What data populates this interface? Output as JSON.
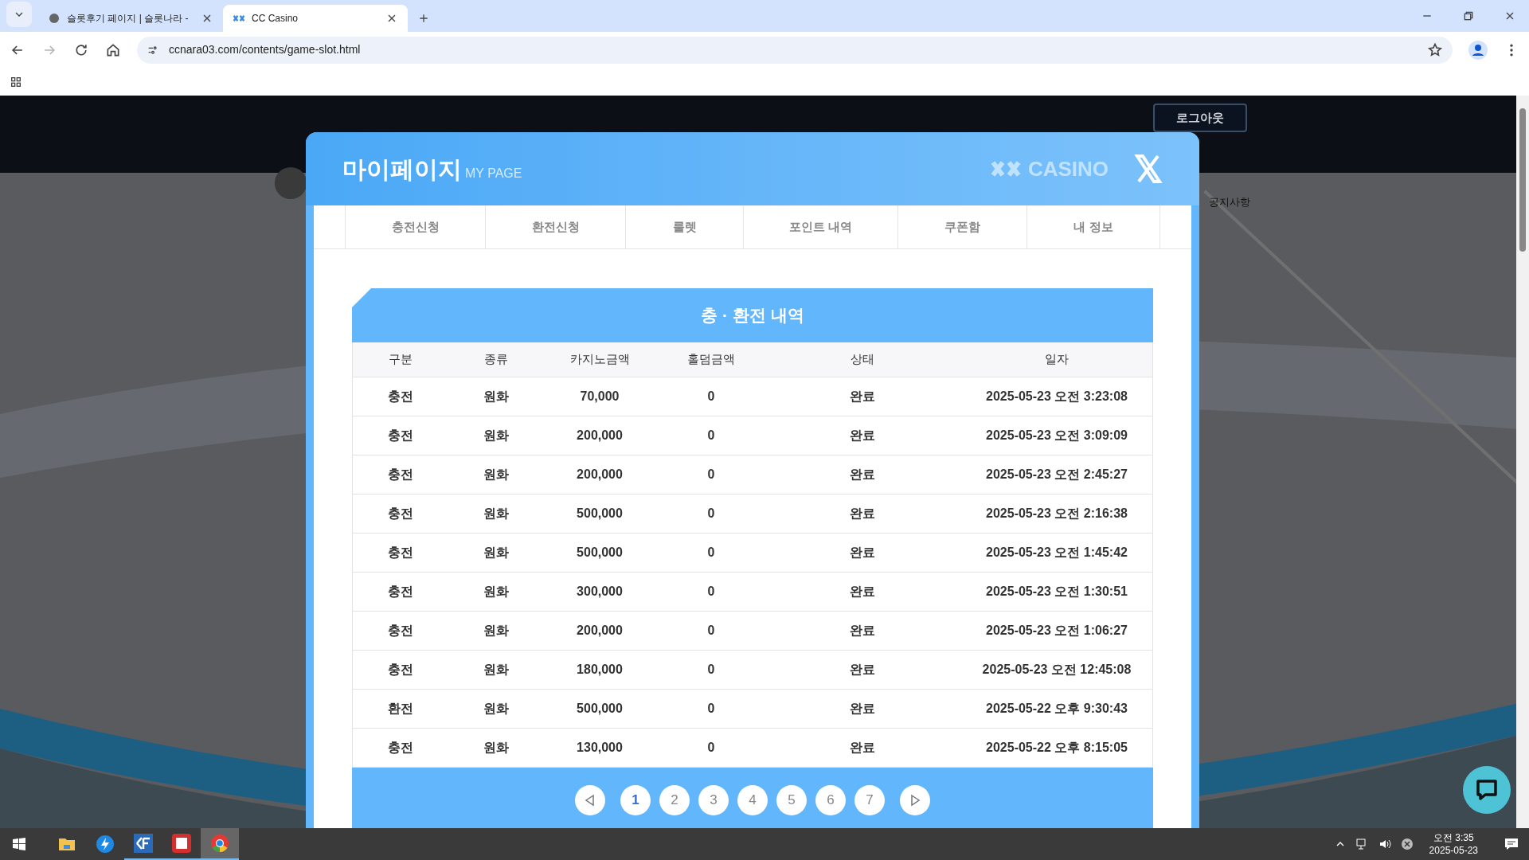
{
  "browser": {
    "tabs": [
      {
        "title": "슬롯후기 페이지 | 슬롯나라 -",
        "selected": false
      },
      {
        "title": "CC Casino",
        "selected": true
      }
    ],
    "url": "ccnara03.com/contents/game-slot.html"
  },
  "site": {
    "logout": "로그아웃",
    "notice": "공지사항"
  },
  "modal": {
    "title": "마이페이지",
    "subtitle": "MY PAGE",
    "logo": "CASINO",
    "tabs": [
      {
        "label": "충전신청",
        "selected": false
      },
      {
        "label": "환전신청",
        "selected": false
      },
      {
        "label": "룰렛",
        "selected": false
      },
      {
        "label": "포인트 내역",
        "selected": false
      },
      {
        "label": "쿠폰함",
        "selected": false
      },
      {
        "label": "내 정보",
        "selected": false
      }
    ],
    "table": {
      "title": "충 · 환전 내역",
      "columns": [
        "구분",
        "종류",
        "카지노금액",
        "홀덤금액",
        "상태",
        "일자"
      ],
      "rows": [
        [
          "충전",
          "원화",
          "70,000",
          "0",
          "완료",
          "2025-05-23 오전 3:23:08"
        ],
        [
          "충전",
          "원화",
          "200,000",
          "0",
          "완료",
          "2025-05-23 오전 3:09:09"
        ],
        [
          "충전",
          "원화",
          "200,000",
          "0",
          "완료",
          "2025-05-23 오전 2:45:27"
        ],
        [
          "충전",
          "원화",
          "500,000",
          "0",
          "완료",
          "2025-05-23 오전 2:16:38"
        ],
        [
          "충전",
          "원화",
          "500,000",
          "0",
          "완료",
          "2025-05-23 오전 1:45:42"
        ],
        [
          "충전",
          "원화",
          "300,000",
          "0",
          "완료",
          "2025-05-23 오전 1:30:51"
        ],
        [
          "충전",
          "원화",
          "200,000",
          "0",
          "완료",
          "2025-05-23 오전 1:06:27"
        ],
        [
          "충전",
          "원화",
          "180,000",
          "0",
          "완료",
          "2025-05-23 오전 12:45:08"
        ],
        [
          "환전",
          "원화",
          "500,000",
          "0",
          "완료",
          "2025-05-22 오후 9:30:43"
        ],
        [
          "충전",
          "원화",
          "130,000",
          "0",
          "완료",
          "2025-05-22 오후 8:15:05"
        ]
      ]
    },
    "pages": [
      {
        "label": "1",
        "selected": true
      },
      {
        "label": "2",
        "selected": false
      },
      {
        "label": "3",
        "selected": false
      },
      {
        "label": "4",
        "selected": false
      },
      {
        "label": "5",
        "selected": false
      },
      {
        "label": "6",
        "selected": false
      },
      {
        "label": "7",
        "selected": false
      }
    ]
  },
  "taskbar": {
    "time": "오전 3:35",
    "date": "2025-05-23"
  }
}
